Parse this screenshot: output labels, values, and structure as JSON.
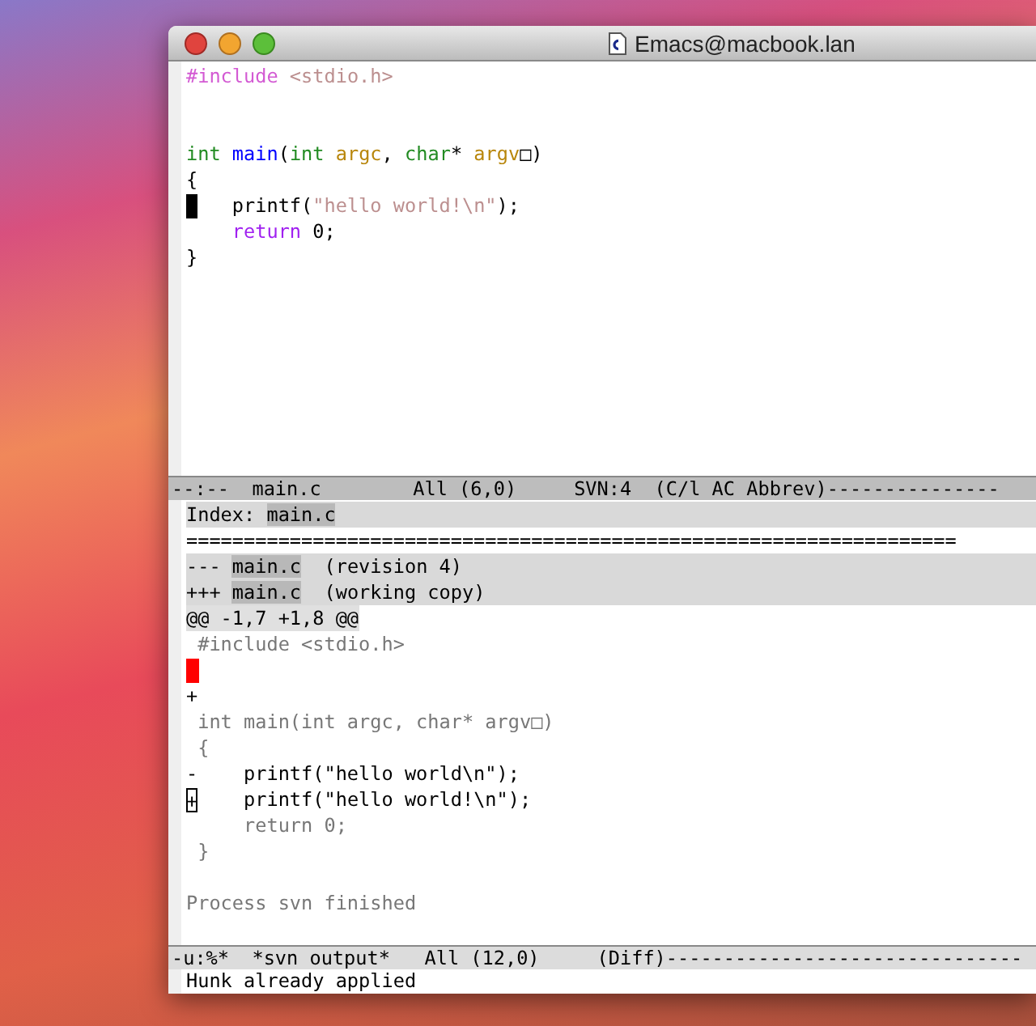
{
  "window": {
    "title": "Emacs@macbook.lan"
  },
  "editor": {
    "selected": true,
    "lines": [
      {
        "kind": "code",
        "cursor": false,
        "segments": [
          {
            "text": "#include",
            "kind": "preprocessor"
          },
          {
            "text": " <stdio.h>",
            "kind": "string"
          }
        ]
      },
      {
        "kind": "blank",
        "cursor": false
      },
      {
        "kind": "blank",
        "cursor": false
      },
      {
        "kind": "code",
        "cursor": false,
        "segments": [
          {
            "text": "int ",
            "kind": "type"
          },
          {
            "text": "main",
            "kind": "function"
          },
          {
            "text": "(",
            "kind": "plain"
          },
          {
            "text": "int ",
            "kind": "type"
          },
          {
            "text": "argc",
            "kind": "variable"
          },
          {
            "text": ", ",
            "kind": "plain"
          },
          {
            "text": "char",
            "kind": "type"
          },
          {
            "text": "* ",
            "kind": "plain"
          },
          {
            "text": "argv",
            "kind": "variable"
          },
          {
            "text": "□)",
            "kind": "plain"
          }
        ]
      },
      {
        "kind": "code",
        "cursor": false,
        "segments": [
          {
            "text": "{",
            "kind": "plain"
          }
        ]
      },
      {
        "kind": "code",
        "cursor": true,
        "segments": [
          {
            "text": "    printf(",
            "kind": "plain"
          },
          {
            "text": "\"hello world!\\n\"",
            "kind": "string"
          },
          {
            "text": ");",
            "kind": "plain"
          }
        ]
      },
      {
        "kind": "code",
        "cursor": false,
        "segments": [
          {
            "text": "    return",
            "kind": "keyword"
          },
          {
            "text": " 0;",
            "kind": "plain"
          }
        ]
      },
      {
        "kind": "code",
        "cursor": false,
        "segments": [
          {
            "text": "}",
            "kind": "plain"
          }
        ]
      }
    ]
  },
  "editor_mode_line": {
    "active": true,
    "text": "--:--  main.c        All (6,0)     SVN:4  (C/l AC Abbrev)---------------"
  },
  "svn_output": {
    "selected": false,
    "lines": [
      {
        "kind": "header",
        "cursor": false,
        "segments": [
          {
            "text": "Index: ",
            "kind": "plain"
          },
          {
            "text": "main.c",
            "kind": "file"
          }
        ]
      },
      {
        "kind": "separator",
        "cursor": false,
        "text": "==================================================================="
      },
      {
        "kind": "header",
        "cursor": false,
        "segments": [
          {
            "text": "--- ",
            "kind": "plain"
          },
          {
            "text": "main.c",
            "kind": "file"
          },
          {
            "text": "  (revision 4)",
            "kind": "plain"
          }
        ]
      },
      {
        "kind": "header",
        "cursor": false,
        "segments": [
          {
            "text": "+++ ",
            "kind": "plain"
          },
          {
            "text": "main.c",
            "kind": "file"
          },
          {
            "text": "  (working copy)",
            "kind": "plain"
          }
        ]
      },
      {
        "kind": "hunk",
        "cursor": false,
        "text": "@@ -1,7 +1,8 @@"
      },
      {
        "kind": "context",
        "cursor": false,
        "text": " #include <stdio.h>"
      },
      {
        "kind": "whitespace-error",
        "cursor": false
      },
      {
        "kind": "added",
        "cursor": false,
        "text": "+"
      },
      {
        "kind": "context",
        "cursor": false,
        "text": " int main(int argc, char* argv□)"
      },
      {
        "kind": "context",
        "cursor": false,
        "text": " {"
      },
      {
        "kind": "removed",
        "cursor": false,
        "text": "-    printf(\"hello world\\n\");"
      },
      {
        "kind": "added",
        "cursor": true,
        "text": "+    printf(\"hello world!\\n\");"
      },
      {
        "kind": "context",
        "cursor": false,
        "text": "     return 0;"
      },
      {
        "kind": "context",
        "cursor": false,
        "text": " }"
      },
      {
        "kind": "blank",
        "cursor": false
      },
      {
        "kind": "message",
        "cursor": false,
        "text": "Process svn finished"
      }
    ]
  },
  "svn_mode_line": {
    "active": false,
    "text": "-u:%*  *svn output*   All (12,0)     (Diff)-------------------------------"
  },
  "echo_area": {
    "text": "Hunk already applied"
  }
}
